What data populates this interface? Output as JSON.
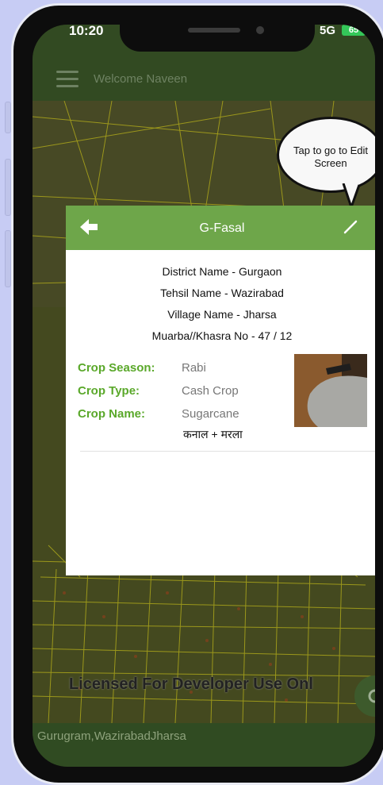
{
  "status_bar": {
    "time": "10:20",
    "signal": "5G",
    "battery": "65"
  },
  "app_bar": {
    "title": "Welcome Naveen"
  },
  "tooltip": {
    "line1": "Tap to go to Edit",
    "line2": "Screen"
  },
  "card": {
    "title": "G-Fasal",
    "district": "District Name - Gurgaon",
    "tehsil": "Tehsil Name - Wazirabad",
    "village": "Village Name - Jharsa",
    "khasra": "Muarba//Khasra No - 47 / 12",
    "crop_season_label": "Crop Season:",
    "crop_season_value": "Rabi",
    "crop_type_label": "Crop Type:",
    "crop_type_value": "Cash Crop",
    "crop_name_label": "Crop Name:",
    "crop_name_value": "Sugarcane",
    "area_units": "कनाल  + मरला"
  },
  "watermark": "Licensed For Developer Use Onl",
  "location": "Gurugram,WazirabadJharsa",
  "colors": {
    "accent": "#6ea64a",
    "label_green": "#5aa82a",
    "app_bar": "#324a22"
  },
  "icons": [
    "menu-icon",
    "back-arrow-icon",
    "edit-pencil-icon",
    "refresh-icon"
  ]
}
